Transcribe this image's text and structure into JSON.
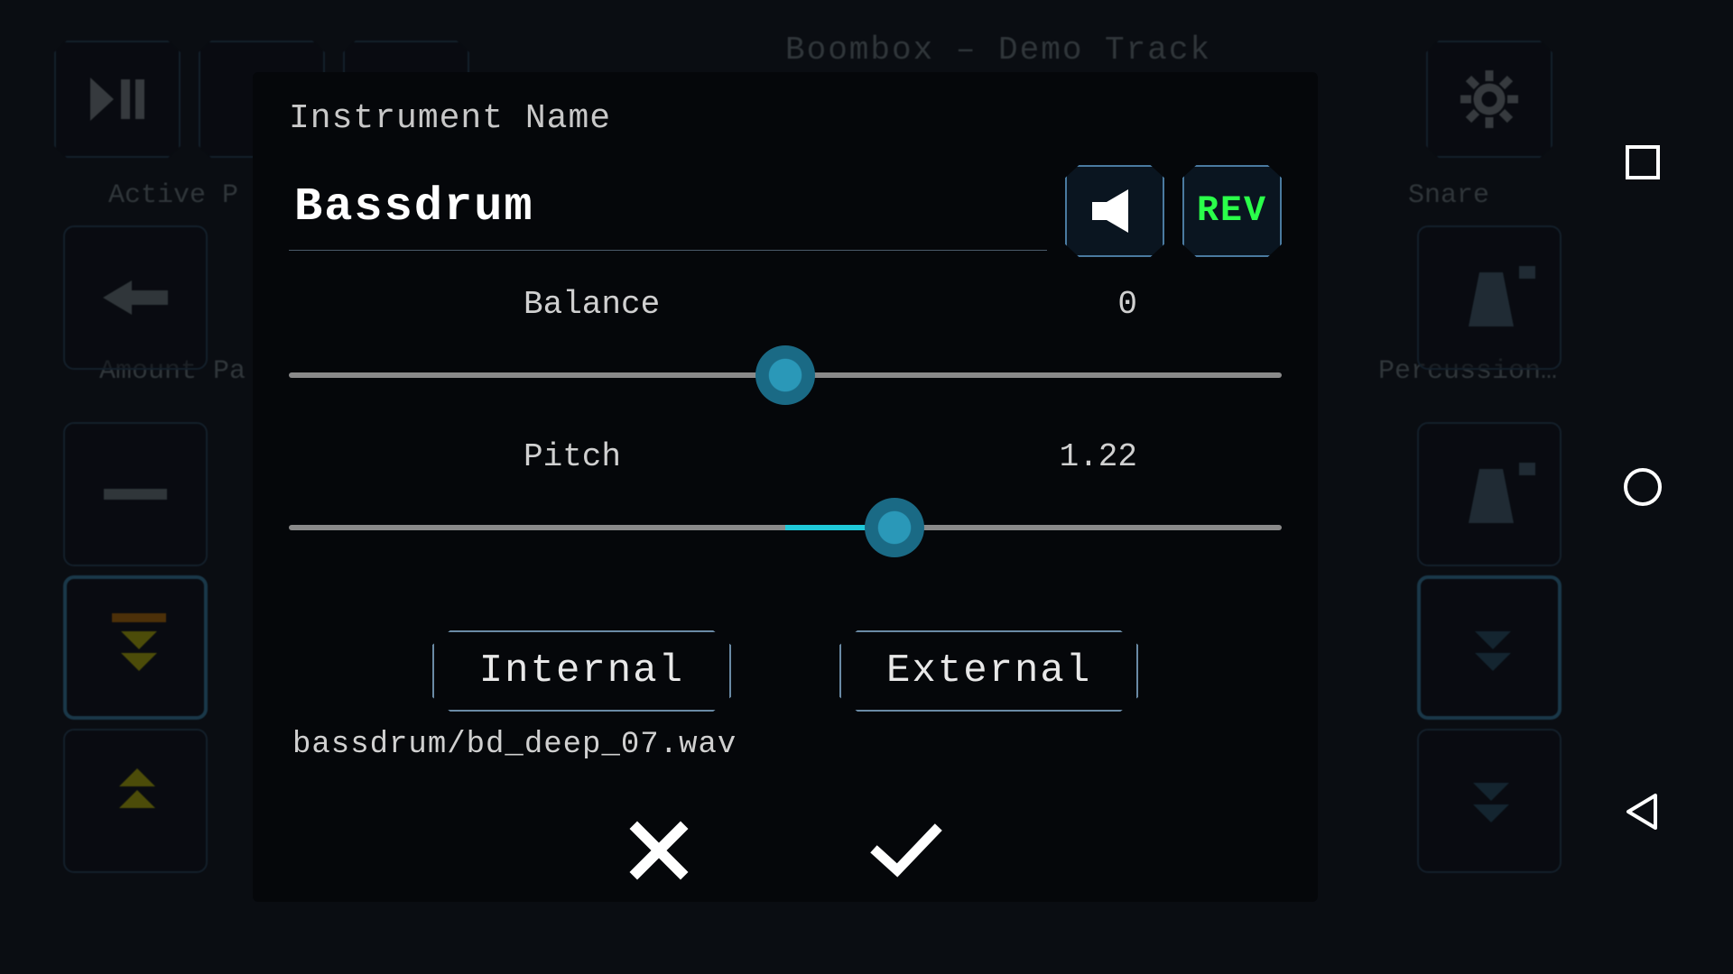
{
  "header": {
    "track_title": "Boombox – Demo Track",
    "labels": {
      "active": "Active P",
      "amount": "Amount Pa",
      "snare": "Snare",
      "percussion": "Percussion…"
    }
  },
  "modal": {
    "title": "Instrument Name",
    "name": "Bassdrum",
    "rev_label": "REV",
    "sliders": {
      "balance": {
        "label": "Balance",
        "value": "0",
        "percent": 50
      },
      "pitch": {
        "label": "Pitch",
        "value": "1.22",
        "percent": 61
      }
    },
    "source": {
      "internal": "Internal",
      "external": "External"
    },
    "file_path": "bassdrum/bd_deep_07.wav"
  }
}
